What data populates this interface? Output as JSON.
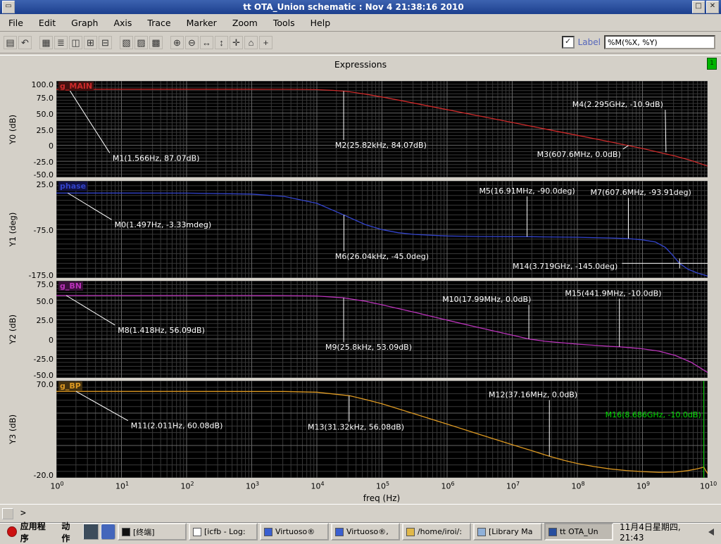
{
  "window": {
    "title": "tt OTA_Union schematic : Nov  4 21:38:16 2010",
    "icons": {
      "menu": "▭",
      "minimize": "□",
      "close": "✕"
    }
  },
  "menu": {
    "items": [
      "File",
      "Edit",
      "Graph",
      "Axis",
      "Trace",
      "Marker",
      "Zoom",
      "Tools",
      "Help"
    ]
  },
  "toolbar": {
    "icons": [
      {
        "name": "print",
        "glyph": "▤",
        "group": 1
      },
      {
        "name": "redraw",
        "glyph": "↶",
        "group": 1
      },
      {
        "name": "graph-window",
        "glyph": "▦",
        "group": 2
      },
      {
        "name": "strip-mode",
        "glyph": "≣",
        "group": 2
      },
      {
        "name": "composite-mode",
        "glyph": "◫",
        "group": 2
      },
      {
        "name": "add-subwindow",
        "glyph": "⊞",
        "group": 2
      },
      {
        "name": "delete-subwindow",
        "glyph": "⊟",
        "group": 2
      },
      {
        "name": "copy",
        "glyph": "▧",
        "group": 3
      },
      {
        "name": "cut",
        "glyph": "▨",
        "group": 3
      },
      {
        "name": "paste",
        "glyph": "▩",
        "group": 3
      },
      {
        "name": "zoom-in",
        "glyph": "⊕",
        "group": 4
      },
      {
        "name": "zoom-out",
        "glyph": "⊖",
        "group": 4
      },
      {
        "name": "zoom-x",
        "glyph": "↔",
        "group": 4
      },
      {
        "name": "zoom-y",
        "glyph": "↕",
        "group": 4
      },
      {
        "name": "pan",
        "glyph": "✛",
        "group": 4
      },
      {
        "name": "fit",
        "glyph": "⌂",
        "group": 4
      },
      {
        "name": "crosshair",
        "glyph": "+",
        "group": 4
      }
    ],
    "checkbox_glyph": "✓",
    "label_checkbox": "Label",
    "label_format": "%M(%X, %Y)"
  },
  "subwindow": {
    "title": "Expressions",
    "indicator": "1"
  },
  "prompt": ">",
  "chart_data": {
    "type": "line",
    "xlabel": "freq (Hz)",
    "x_unit": "log10(Hz)",
    "x_range": [
      0,
      10
    ],
    "xticks": [
      0,
      1,
      2,
      3,
      4,
      5,
      6,
      7,
      8,
      9,
      10
    ],
    "plots": [
      {
        "id": "y0",
        "trace_name": "g_MAIN",
        "color": "#cc2a2a",
        "label_bg": "#43100f",
        "ylabel": "Y0 (dB)",
        "ymin": -50,
        "ymax": 100,
        "grid_minor": 5,
        "grid_major": 25,
        "yticks": [
          {
            "v": 100,
            "label": "100.0"
          },
          {
            "v": 75,
            "label": "75.0"
          },
          {
            "v": 50,
            "label": "50.0"
          },
          {
            "v": 25,
            "label": "25.0"
          },
          {
            "v": 0,
            "label": "0"
          },
          {
            "v": -25,
            "label": "-25.0"
          },
          {
            "v": -50,
            "label": "-50.0"
          }
        ],
        "series": [
          [
            0,
            87.07
          ],
          [
            1,
            87.07
          ],
          [
            2,
            87.07
          ],
          [
            3,
            87.06
          ],
          [
            3.5,
            87.0
          ],
          [
            3.75,
            86.87
          ],
          [
            4,
            86.46
          ],
          [
            4.25,
            85.38
          ],
          [
            4.41,
            84.07
          ],
          [
            4.5,
            83.09
          ],
          [
            4.75,
            79.47
          ],
          [
            5,
            75.02
          ],
          [
            5.25,
            70.21
          ],
          [
            5.5,
            65.34
          ],
          [
            6,
            55.35
          ],
          [
            6.5,
            45.35
          ],
          [
            7,
            35.35
          ],
          [
            7.5,
            25.35
          ],
          [
            8,
            15.35
          ],
          [
            8.5,
            5.25
          ],
          [
            8.78,
            -0.55
          ],
          [
            9,
            -5.16
          ],
          [
            9.25,
            -11.0
          ],
          [
            9.5,
            -16.8
          ],
          [
            9.75,
            -23.8
          ],
          [
            10,
            -32.5
          ]
        ],
        "markers": [
          {
            "text": "M1(1.566Hz, 87.07dB)",
            "ax": 0.195,
            "ay": 87.07,
            "tx": 0.82,
            "ty": -12,
            "ta": "start",
            "line": "d"
          },
          {
            "text": "M2(25.82kHz, 84.07dB)",
            "ax": 4.4116,
            "ay": 84.07,
            "tx": 4.28,
            "ty": 8,
            "ta": "start",
            "line": "v"
          },
          {
            "text": "M3(607.6MHz, 0.0dB)",
            "ax": 8.784,
            "ay": -0.38,
            "tx": 8.7,
            "ty": -6,
            "ta": "end",
            "line": "d"
          },
          {
            "text": "M4(2.295GHz, -10.9dB)",
            "ax": 9.3608,
            "ay": -10.9,
            "tx": 9.35,
            "ty": 55,
            "ta": "end",
            "line": "d"
          }
        ]
      },
      {
        "id": "y1",
        "trace_name": "phase",
        "color": "#3344cc",
        "label_bg": "#101043",
        "ylabel": "Y1 (deg)",
        "ymin": -175,
        "ymax": 25,
        "grid_minor": 10,
        "grid_major": 100,
        "yticks": [
          {
            "v": 25,
            "label": "25.0"
          },
          {
            "v": -75,
            "label": "-75.0"
          },
          {
            "v": -175,
            "label": "-175.0"
          }
        ],
        "series": [
          [
            0,
            -0.003
          ],
          [
            1,
            -0.02
          ],
          [
            2,
            -0.22
          ],
          [
            3,
            -2.2
          ],
          [
            3.5,
            -7.0
          ],
          [
            4,
            -21.2
          ],
          [
            4.41,
            -45
          ],
          [
            4.75,
            -65.4
          ],
          [
            5,
            -75.5
          ],
          [
            5.25,
            -81.8
          ],
          [
            5.5,
            -85.3
          ],
          [
            6,
            -88.5
          ],
          [
            6.5,
            -89.6
          ],
          [
            7,
            -89.9
          ],
          [
            7.25,
            -90.0
          ],
          [
            7.5,
            -90.3
          ],
          [
            8,
            -91.1
          ],
          [
            8.5,
            -92.5
          ],
          [
            8.78,
            -93.9
          ],
          [
            9,
            -96.5
          ],
          [
            9.2,
            -101
          ],
          [
            9.35,
            -112
          ],
          [
            9.45,
            -126
          ],
          [
            9.57,
            -145
          ],
          [
            9.7,
            -157
          ],
          [
            9.85,
            -165
          ],
          [
            10,
            -171
          ]
        ],
        "markers": [
          {
            "text": "M0(1.497Hz, -3.33mdeg)",
            "ax": 0.175,
            "ay": -0.003,
            "tx": 0.85,
            "ty": -55,
            "ta": "start",
            "line": "d"
          },
          {
            "text": "M6(26.04kHz, -45.0deg)",
            "ax": 4.4157,
            "ay": -45,
            "tx": 4.28,
            "ty": -120,
            "ta": "start",
            "line": "v"
          },
          {
            "text": "M5(16.91MHz, -90.0deg)",
            "ax": 7.2281,
            "ay": -90,
            "tx": 7.2281,
            "ty": -7,
            "ta": "middle",
            "line": "v"
          },
          {
            "text": "M7(607.6MHz, -93.91deg)",
            "ax": 8.784,
            "ay": -93.91,
            "tx": 8.2,
            "ty": -10,
            "ta": "start",
            "line": "v"
          },
          {
            "text": "M14(3.719GHz, -145.0deg)",
            "ax": 9.5705,
            "ay": -145,
            "tx": 8.62,
            "ty": -150,
            "ta": "end",
            "line": "h"
          }
        ]
      },
      {
        "id": "y2",
        "trace_name": "g_BN",
        "color": "#bb33bb",
        "label_bg": "#3a0f3a",
        "ylabel": "Y2 (dB)",
        "ymin": -50,
        "ymax": 75,
        "grid_minor": 5,
        "grid_major": 25,
        "yticks": [
          {
            "v": 75,
            "label": "75.0"
          },
          {
            "v": 50,
            "label": "50.0"
          },
          {
            "v": 25,
            "label": "25.0"
          },
          {
            "v": 0,
            "label": "0"
          },
          {
            "v": -25,
            "label": "-25.0"
          },
          {
            "v": -50,
            "label": "-50.0"
          }
        ],
        "series": [
          [
            0,
            56.09
          ],
          [
            2,
            56.09
          ],
          [
            3,
            56.05
          ],
          [
            3.5,
            56.0
          ],
          [
            4,
            55.48
          ],
          [
            4.41,
            53.09
          ],
          [
            4.75,
            48.6
          ],
          [
            5,
            44.1
          ],
          [
            5.5,
            34.4
          ],
          [
            6,
            24.4
          ],
          [
            6.5,
            14.5
          ],
          [
            7,
            5.0
          ],
          [
            7.26,
            0.0
          ],
          [
            7.5,
            -2.8
          ],
          [
            8,
            -6.5
          ],
          [
            8.5,
            -9.3
          ],
          [
            8.65,
            -10.0
          ],
          [
            9,
            -12.5
          ],
          [
            9.25,
            -15.5
          ],
          [
            9.5,
            -21.0
          ],
          [
            9.75,
            -30.0
          ],
          [
            10,
            -43.0
          ]
        ],
        "markers": [
          {
            "text": "M8(1.418Hz, 56.09dB)",
            "ax": 0.1517,
            "ay": 56.09,
            "tx": 0.9,
            "ty": 18,
            "ta": "start",
            "line": "d"
          },
          {
            "text": "M9(25.8kHz, 53.09dB)",
            "ax": 4.4116,
            "ay": 53.09,
            "tx": 4.13,
            "ty": -4,
            "ta": "start",
            "line": "v"
          },
          {
            "text": "M10(17.99MHz, 0.0dB)",
            "ax": 7.2551,
            "ay": 0,
            "tx": 7.29,
            "ty": 44,
            "ta": "end",
            "line": "v"
          },
          {
            "text": "M15(441.9MHz, -10.0dB)",
            "ax": 8.6453,
            "ay": -10,
            "tx": 8.55,
            "ty": 52,
            "ta": "middle",
            "line": "v"
          }
        ]
      },
      {
        "id": "y3",
        "trace_name": "g_BP",
        "color": "#dd9922",
        "label_bg": "#43310f",
        "ylabel": "Y3 (dB)",
        "ymin": -20,
        "ymax": 70,
        "grid_minor": 6,
        "grid_major": 30,
        "yticks": [
          {
            "v": 70,
            "label": "70.0"
          },
          {
            "v": -20,
            "label": "-20.0"
          }
        ],
        "series": [
          [
            0,
            60.08
          ],
          [
            2,
            60.08
          ],
          [
            3,
            60.05
          ],
          [
            3.5,
            60.0
          ],
          [
            4,
            59.4
          ],
          [
            4.5,
            56.08
          ],
          [
            4.75,
            52.6
          ],
          [
            5,
            48.6
          ],
          [
            5.5,
            39.3
          ],
          [
            6,
            29.8
          ],
          [
            6.5,
            20.2
          ],
          [
            7,
            10.7
          ],
          [
            7.3,
            5.2
          ],
          [
            7.57,
            0.0
          ],
          [
            7.8,
            -3.9
          ],
          [
            8,
            -6.7
          ],
          [
            8.25,
            -9.5
          ],
          [
            8.5,
            -11.7
          ],
          [
            8.75,
            -13.2
          ],
          [
            9,
            -14.2
          ],
          [
            9.25,
            -14.9
          ],
          [
            9.5,
            -14.7
          ],
          [
            9.7,
            -13.3
          ],
          [
            9.85,
            -11.5
          ],
          [
            9.94,
            -10.0
          ],
          [
            10,
            -16.0
          ]
        ],
        "markers": [
          {
            "text": "M11(2.011Hz, 60.08dB)",
            "ax": 0.3034,
            "ay": 60.08,
            "tx": 1.1,
            "ty": 33,
            "ta": "start",
            "line": "d"
          },
          {
            "text": "M13(31.32kHz, 56.08dB)",
            "ax": 4.4958,
            "ay": 56.08,
            "tx": 3.86,
            "ty": 32,
            "ta": "start",
            "line": "v"
          },
          {
            "text": "M12(37.16MHz, 0.0dB)",
            "ax": 7.5701,
            "ay": 0,
            "tx": 7.32,
            "ty": 52,
            "ta": "middle",
            "line": "v"
          },
          {
            "text": "M16(8.686GHz, -10.0dB)",
            "ax": 9.9388,
            "ay": -10,
            "tx": 9.9,
            "ty": 36,
            "ta": "end",
            "line": "full",
            "color": "#00dd00"
          }
        ]
      }
    ]
  },
  "taskbar": {
    "menus": [
      "应用程序",
      "动作"
    ],
    "launchers": [
      "screenshot",
      "email"
    ],
    "windows": [
      {
        "label": "[终端]",
        "icon": "terminal",
        "active": false
      },
      {
        "label": "[icfb - Log:",
        "icon": "document",
        "active": false
      },
      {
        "label": "Virtuoso®",
        "icon": "app",
        "active": false
      },
      {
        "label": "Virtuoso®,",
        "icon": "app",
        "active": false
      },
      {
        "label": "/home/iroi/:",
        "icon": "folder",
        "active": false
      },
      {
        "label": "[Library Ma",
        "icon": "library",
        "active": false
      },
      {
        "label": "tt OTA_Un",
        "icon": "waveform",
        "active": true
      }
    ],
    "clock": "11月4日星期四, 21:43"
  }
}
